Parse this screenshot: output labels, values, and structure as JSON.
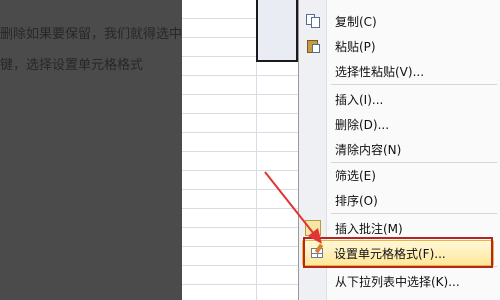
{
  "article": {
    "line1": "删除如果要保留，我们就得选中",
    "line2": "键，选择设置单元格格式"
  },
  "context_menu": {
    "items": [
      {
        "label": "复制(C)",
        "icon": "copy-icon"
      },
      {
        "label": "粘贴(P)",
        "icon": "paste-icon"
      },
      {
        "label": "选择性粘贴(V)...",
        "icon": ""
      },
      {
        "label": "插入(I)...",
        "icon": ""
      },
      {
        "label": "删除(D)...",
        "icon": ""
      },
      {
        "label": "清除内容(N)",
        "icon": ""
      },
      {
        "label": "筛选(E)",
        "icon": ""
      },
      {
        "label": "排序(O)",
        "icon": ""
      },
      {
        "label": "插入批注(M)",
        "icon": "insert-comment-icon"
      },
      {
        "label": "设置单元格格式(F)...",
        "icon": "format-cells-icon"
      },
      {
        "label": "从下拉列表中选择(K)...",
        "icon": ""
      }
    ]
  },
  "colors": {
    "highlight_fill": "#ffe79a",
    "annotation_red": "#e33333",
    "overlay_dark": "#4b4b4b"
  }
}
